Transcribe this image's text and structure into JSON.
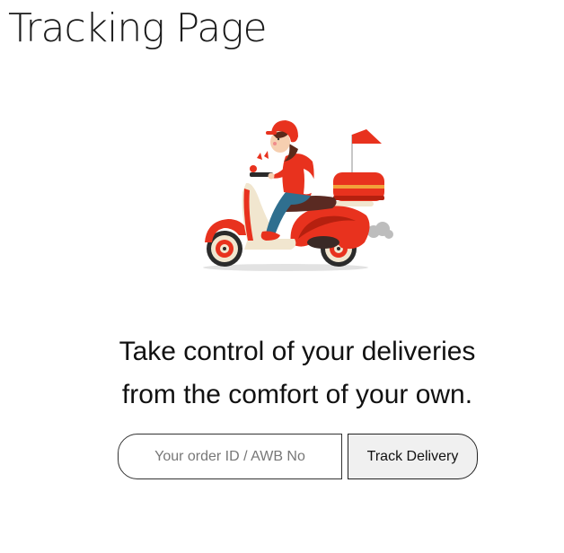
{
  "page": {
    "title": "Tracking Page"
  },
  "illustration": {
    "icon": "delivery-scooter-rider-illustration",
    "colors": {
      "primary_red": "#e8321e",
      "dark_red": "#b5200f",
      "cream": "#f1e6cf",
      "jeans": "#2f6f8f",
      "skin": "#f6cfb0",
      "hair": "#5a2a1a",
      "seat": "#5a2a22",
      "shadow": "#e2e2e2",
      "smoke": "#bdbdbd",
      "box_stripe": "#f2a23a"
    }
  },
  "tagline": {
    "line1": "Take control of your deliveries",
    "line2": "from the comfort of your own."
  },
  "tracking_form": {
    "order_input": {
      "value": "",
      "placeholder": "Your order ID / AWB No"
    },
    "submit_label": "Track Delivery"
  }
}
